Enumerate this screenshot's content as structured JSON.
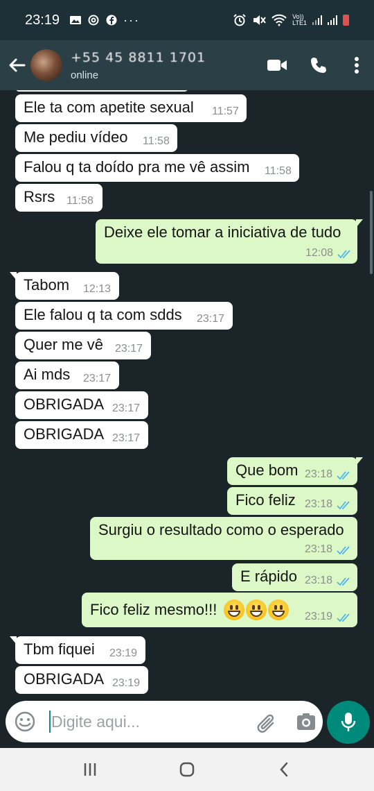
{
  "status_bar": {
    "time": "23:19",
    "network_label": "LTE1",
    "volte_label": "Vo))",
    "icons": [
      "gallery-icon",
      "at-icon",
      "facebook-icon",
      "more-dots-icon",
      "alarm-icon",
      "mute-icon",
      "wifi-icon",
      "signal-icon",
      "signal-icon",
      "battery-icon"
    ]
  },
  "header": {
    "contact_name": "+55 45 8811 1701",
    "status": "online",
    "icons": [
      "back-arrow-icon",
      "video-call-icon",
      "phone-icon",
      "more-vert-icon"
    ],
    "bg_color": "#2b3f47"
  },
  "messages": [
    {
      "text": "Ele ta com apetite sexual",
      "time": "11:57",
      "dir": "in"
    },
    {
      "text": "Me pediu vídeo",
      "time": "11:58",
      "dir": "in"
    },
    {
      "text": "Falou q ta doído pra me vê assim",
      "time": "11:58",
      "dir": "in"
    },
    {
      "text": "Rsrs",
      "time": "11:58",
      "dir": "in"
    },
    {
      "text": "Deixe ele tomar a iniciativa de tudo",
      "time": "12:08",
      "dir": "out",
      "read": true
    },
    {
      "text": "Tabom",
      "time": "12:13",
      "dir": "in"
    },
    {
      "text": "Ele falou q ta com sdds",
      "time": "23:17",
      "dir": "in"
    },
    {
      "text": "Quer me vê",
      "time": "23:17",
      "dir": "in"
    },
    {
      "text": "Ai mds",
      "time": "23:17",
      "dir": "in"
    },
    {
      "text": "OBRIGADA",
      "time": "23:17",
      "dir": "in"
    },
    {
      "text": "OBRIGADA",
      "time": "23:17",
      "dir": "in"
    },
    {
      "text": "Que bom",
      "time": "23:18",
      "dir": "out",
      "read": true
    },
    {
      "text": "Fico feliz",
      "time": "23:18",
      "dir": "out",
      "read": true
    },
    {
      "text": "Surgiu o resultado como o esperado",
      "time": "23:18",
      "dir": "out",
      "read": true
    },
    {
      "text": "E rápido",
      "time": "23:18",
      "dir": "out",
      "read": true
    },
    {
      "text": "Fico feliz mesmo!!!",
      "emojis": [
        "grinning-face-emoji",
        "grinning-face-emoji",
        "grinning-face-emoji"
      ],
      "time": "23:19",
      "dir": "out",
      "read": true
    },
    {
      "text": "Tbm fiquei",
      "time": "23:19",
      "dir": "in"
    },
    {
      "text": "OBRIGADA",
      "time": "23:19",
      "dir": "in"
    }
  ],
  "input": {
    "placeholder": "Digite aqui...",
    "value": "",
    "icons": [
      "emoji-icon",
      "attach-icon",
      "camera-icon",
      "mic-icon"
    ]
  },
  "nav_bar": {
    "icons": [
      "recent-apps-icon",
      "home-icon",
      "back-icon"
    ]
  },
  "colors": {
    "chat_bg": "#1b2428",
    "incoming": "#ffffff",
    "outgoing": "#dcf8c6",
    "read_ticks": "#4fb6ec",
    "accent": "#008a7c"
  }
}
